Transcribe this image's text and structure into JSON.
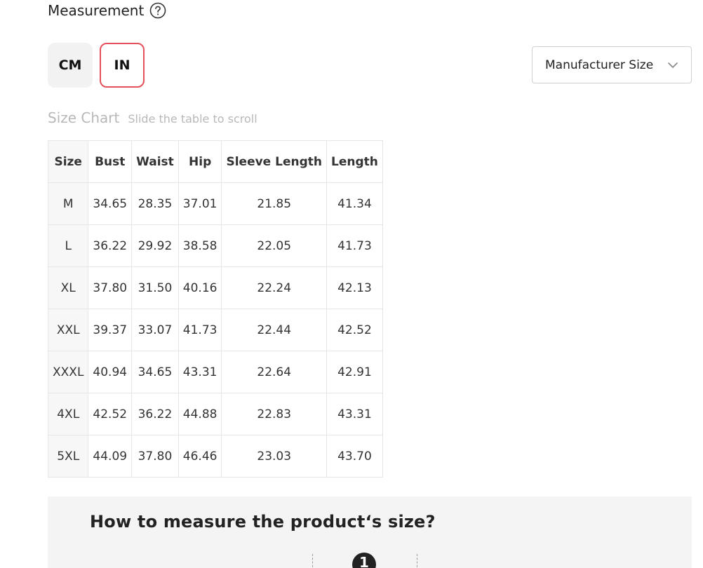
{
  "measurement": {
    "title": "Measurement",
    "help_icon": "question-circle-icon"
  },
  "units": {
    "cm_label": "CM",
    "in_label": "IN",
    "selected": "IN",
    "selected_border_color": "#e6505a"
  },
  "size_select": {
    "value": "Manufacturer Size",
    "icon": "chevron-down-icon"
  },
  "size_chart": {
    "title": "Size Chart",
    "hint": "Slide the table to scroll",
    "headers": [
      "Size",
      "Bust",
      "Waist",
      "Hip",
      "Sleeve Length",
      "Length"
    ],
    "rows": [
      [
        "M",
        "34.65",
        "28.35",
        "37.01",
        "21.85",
        "41.34"
      ],
      [
        "L",
        "36.22",
        "29.92",
        "38.58",
        "22.05",
        "41.73"
      ],
      [
        "XL",
        "37.80",
        "31.50",
        "40.16",
        "22.24",
        "42.13"
      ],
      [
        "XXL",
        "39.37",
        "33.07",
        "41.73",
        "22.44",
        "42.52"
      ],
      [
        "XXXL",
        "40.94",
        "34.65",
        "43.31",
        "22.64",
        "42.91"
      ],
      [
        "4XL",
        "42.52",
        "36.22",
        "44.88",
        "22.83",
        "43.31"
      ],
      [
        "5XL",
        "44.09",
        "37.80",
        "46.46",
        "23.03",
        "43.70"
      ]
    ]
  },
  "guide": {
    "title": "How to measure the product‘s size?",
    "step_number": "1"
  }
}
